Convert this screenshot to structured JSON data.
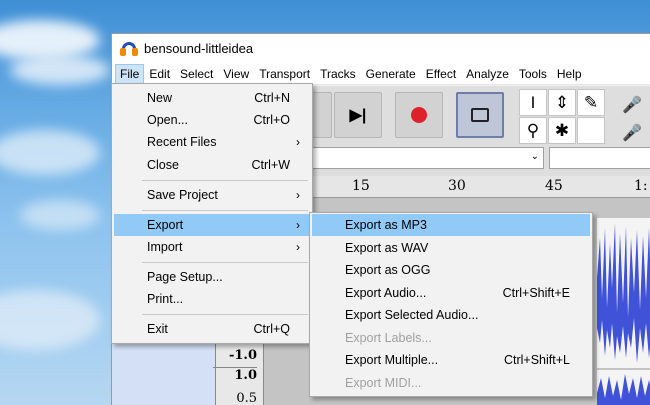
{
  "window": {
    "title": "bensound-littleidea"
  },
  "menubar": [
    "File",
    "Edit",
    "Select",
    "View",
    "Transport",
    "Tracks",
    "Generate",
    "Effect",
    "Analyze",
    "Tools",
    "Help"
  ],
  "file_menu": {
    "new": {
      "label": "New",
      "shortcut": "Ctrl+N"
    },
    "open": {
      "label": "Open...",
      "shortcut": "Ctrl+O"
    },
    "recent": {
      "label": "Recent Files"
    },
    "close": {
      "label": "Close",
      "shortcut": "Ctrl+W"
    },
    "save_project": {
      "label": "Save Project"
    },
    "export": {
      "label": "Export"
    },
    "import": {
      "label": "Import"
    },
    "page_setup": {
      "label": "Page Setup..."
    },
    "print": {
      "label": "Print..."
    },
    "exit": {
      "label": "Exit",
      "shortcut": "Ctrl+Q"
    }
  },
  "export_menu": {
    "mp3": {
      "label": "Export as MP3"
    },
    "wav": {
      "label": "Export as WAV"
    },
    "ogg": {
      "label": "Export as OGG"
    },
    "audio": {
      "label": "Export Audio...",
      "shortcut": "Ctrl+Shift+E"
    },
    "selected": {
      "label": "Export Selected Audio..."
    },
    "labels": {
      "label": "Export Labels..."
    },
    "multiple": {
      "label": "Export Multiple...",
      "shortcut": "Ctrl+Shift+L"
    },
    "midi": {
      "label": "Export MIDI..."
    }
  },
  "ruler": {
    "t15": "15",
    "t30": "30",
    "t45": "45",
    "t60": "1:"
  },
  "vscale": {
    "a": "-1.0",
    "b": "1.0",
    "c": "0.5"
  },
  "colors": {
    "highlight": "#91c9f7",
    "waveform": "#3f52d8",
    "record": "#e0202a"
  }
}
